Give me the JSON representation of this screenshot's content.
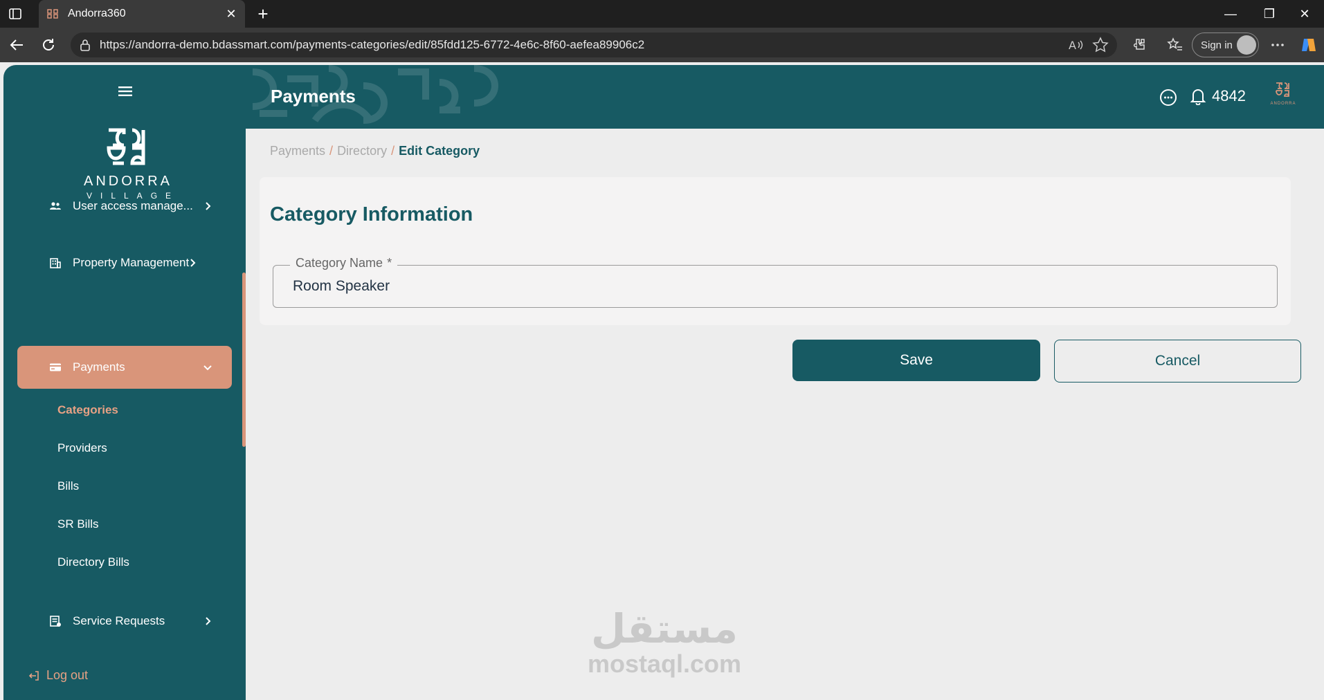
{
  "browser": {
    "tab_title": "Andorra360",
    "tab_close": "✕",
    "new_tab": "+",
    "url": "https://andorra-demo.bdassmart.com/payments-categories/edit/85fdd125-6772-4e6c-8f60-aefea89906c2",
    "sign_in": "Sign in",
    "window": {
      "minimize": "—",
      "restore": "❐",
      "close": "✕"
    }
  },
  "sidebar": {
    "brand": {
      "name": "ANDORRA",
      "sub": "VILLAGE"
    },
    "items": [
      {
        "label": "User access manage...",
        "icon": "users-icon"
      },
      {
        "label": "Property Management",
        "icon": "building-icon"
      },
      {
        "label": "Payments",
        "icon": "card-icon",
        "active": true
      },
      {
        "label": "Service Requests",
        "icon": "requests-icon"
      }
    ],
    "payments_sub": [
      {
        "label": "Categories",
        "active": true
      },
      {
        "label": "Providers"
      },
      {
        "label": "Bills"
      },
      {
        "label": "SR Bills"
      },
      {
        "label": "Directory Bills"
      }
    ],
    "logout": "Log out"
  },
  "header": {
    "title": "Payments",
    "notification_count": "4842"
  },
  "breadcrumb": {
    "items": [
      "Payments",
      "Directory"
    ],
    "separator": "/",
    "current": "Edit Category"
  },
  "form": {
    "section_title": "Category Information",
    "category_name": {
      "label": "Category Name",
      "required_mark": "*",
      "value": "Room Speaker"
    },
    "save_label": "Save",
    "cancel_label": "Cancel"
  },
  "watermark": {
    "arabic": "مستقل",
    "latin": "mostaql.com"
  },
  "colors": {
    "primary": "#175a63",
    "accent": "#d9957a",
    "background": "#ededed"
  }
}
